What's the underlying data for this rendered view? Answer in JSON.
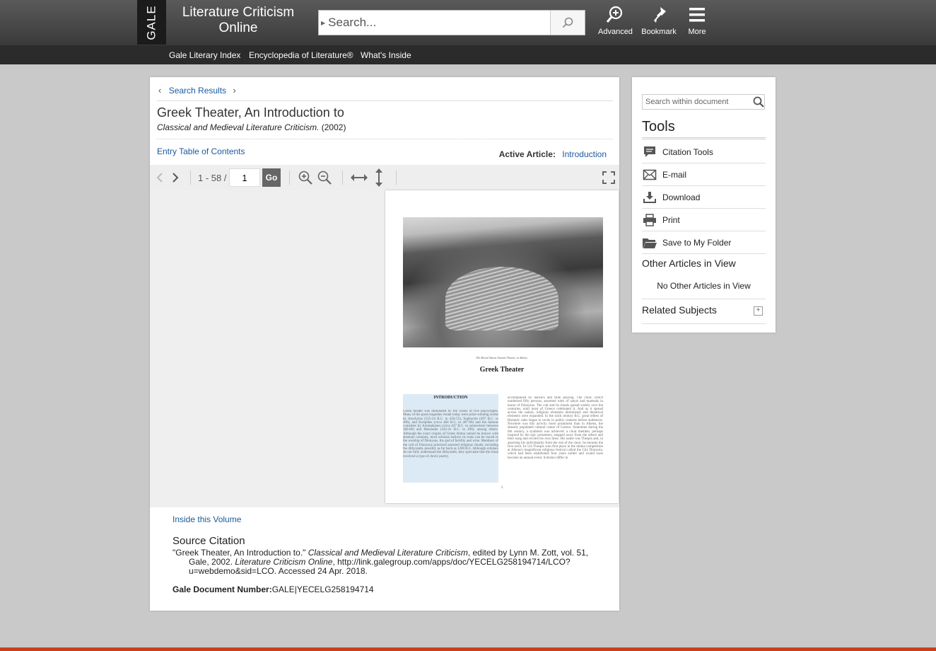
{
  "header": {
    "logo": "GALE",
    "product_title": "Literature Criticism Online",
    "search_placeholder": "Search...",
    "tools": [
      {
        "label": "Advanced",
        "icon": "advanced-search-icon"
      },
      {
        "label": "Bookmark",
        "icon": "bookmark-icon"
      },
      {
        "label": "More",
        "icon": "menu-icon"
      }
    ]
  },
  "nav": {
    "links": [
      "Gale Literary Index",
      "Encyclopedia of Literature®",
      "What's Inside"
    ]
  },
  "document": {
    "breadcrumb": "Search Results",
    "title": "Greek Theater, An Introduction to",
    "source_title": "Classical and Medieval Literature Criticism.",
    "source_year": "(2002)",
    "toc_link": "Entry Table of Contents",
    "active_article_label": "Active Article:",
    "active_article_value": "Introduction"
  },
  "viewer": {
    "page_range": "1 - 58 /",
    "page_value": "1",
    "go_label": "Go"
  },
  "page_image": {
    "caption": "The Herod Atticus Ancient Theatre, in Athens.",
    "heading": "Greek Theater",
    "section_head": "INTRODUCTION",
    "col1": "Greek theater was dominated by the works of five playwrights. Many of the great tragedies extant today were prize-winning works by Aeschylus (525-24 B.C. to 456-55), Sophocles (497 B.C. to 406), and Euripides (circa 484 B.C. to 407-06) and the famous comedies by Aristophanes (circa 447 B.C. to somewhere between 386-80) and Menander (342-41 B.C. to 290), among others. Although the exact origins of Greek drama cannot be known with absolute certainty, most scholars believe its roots can be traced to the worship of Dionysus, the god of fertility and wine. Members of the cult of Dionysus practiced assorted religious rituals, including the dithyramb, possibly as far back as 1200 B.C. Although scholars do not fully understand the dithyramb, they speculate that the ritual involved a type of choric poetry,",
    "col2": "accompanied by dancers and flute playing. The choir, which numbered fifty persons, assumed roles of satyrs and maenads in honor of Dionysus. The cult and its rituals spread widely over the centuries, until most of Greece celebrated it. And as it spread across the nation, religious elements diminished and theatrical elements were expanded. In the sixth century B.C. great tellers of Homeric tales began to recite in public contests before audiences. Nowhere was this activity more prominent than in Athens, the densely populated cultural center of Greece. Sometime during the 6th century, a synthesis was achieved: a choir member, perhaps inspired by the epic presenters, stepped away from the others and their song and recited his own lines. His name was Thespis and, in asserting his individuality from the rest of the choir, he became the first actor. In 534 Thespis won first place in the drama competition at Athens's magnificent religious festival called the City Dionysia, which had been established four years earlier and would soon become an annual event. Scholars differ in",
    "page_number": "1"
  },
  "footer_section": {
    "inside_volume": "Inside this Volume",
    "source_citation_head": "Source Citation",
    "citation_part1": "\"Greek Theater, An Introduction to.\" ",
    "citation_italic1": "Classical and Medieval Literature Criticism",
    "citation_part2": ", edited by Lynn M. Zott, vol. 51, Gale, 2002. ",
    "citation_italic2": "Literature Criticism Online",
    "citation_part3": ", http://link.galegroup.com/apps/doc/YECELG258194714/LCO?u=webdemo&sid=LCO. Accessed 24 Apr. 2018.",
    "doc_number_label": "Gale Document Number:",
    "doc_number_value": "GALE|YECELG258194714"
  },
  "sidebar": {
    "search_placeholder": "Search within document",
    "tools_head": "Tools",
    "tools": [
      {
        "label": "Citation Tools",
        "icon": "citation-icon"
      },
      {
        "label": "E-mail",
        "icon": "email-icon"
      },
      {
        "label": "Download",
        "icon": "download-icon"
      },
      {
        "label": "Print",
        "icon": "print-icon"
      },
      {
        "label": "Save to My Folder",
        "icon": "folder-icon"
      }
    ],
    "other_articles_head": "Other Articles in View",
    "other_articles_empty": "No Other Articles in View",
    "related_subjects": "Related Subjects"
  },
  "colors": {
    "header_bg": "#3a3a3a",
    "nav_bg": "#2b2b2b",
    "link": "#1a5a9c",
    "page_bg": "#c9c9c9",
    "accent_bottom": "#c8401c"
  }
}
